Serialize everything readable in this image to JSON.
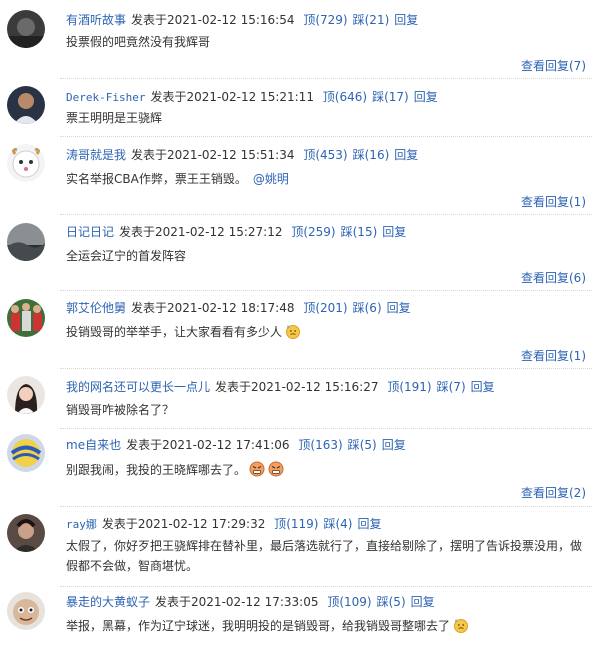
{
  "labels": {
    "posted_prefix": "发表于",
    "up_label": "顶",
    "down_label": "踩",
    "reply_label": "回复",
    "view_replies_label": "查看回复"
  },
  "comments": [
    {
      "username": "有酒听故事",
      "datetime": "2021-02-12 15:16:54",
      "up": "(729)",
      "down": "(21)",
      "text": "投票假的吧竟然没有我辉哥",
      "view_count": "(7)",
      "avatar": "avatar-dark-photo"
    },
    {
      "username": "Derek-Fisher",
      "datetime": "2021-02-12 15:21:11",
      "up": "(646)",
      "down": "(17)",
      "text": "票王明明是王骁辉",
      "avatar": "avatar-player-photo"
    },
    {
      "username": "涛哥就是我",
      "datetime": "2021-02-12 15:51:34",
      "up": "(453)",
      "down": "(16)",
      "text": "实名举报CBA作弊，票王王销毁。",
      "mention": "@姚明",
      "view_count": "(1)",
      "avatar": "avatar-cartoon-sheep"
    },
    {
      "username": "日记日记",
      "datetime": "2021-02-12 15:27:12",
      "up": "(259)",
      "down": "(15)",
      "text": "全运会辽宁的首发阵容",
      "view_count": "(6)",
      "avatar": "avatar-grey-landscape"
    },
    {
      "username": "郭艾伦他舅",
      "datetime": "2021-02-12 18:17:48",
      "up": "(201)",
      "down": "(6)",
      "text": "投销毁哥的举举手，让大家看看有多少人",
      "emoji": "sweat-emoji",
      "view_count": "(1)",
      "avatar": "avatar-team-photo"
    },
    {
      "username": "我的网名还可以更长一点儿",
      "datetime": "2021-02-12 15:16:27",
      "up": "(191)",
      "down": "(7)",
      "text": "销毁哥咋被除名了？",
      "avatar": "avatar-girl-photo"
    },
    {
      "username": "me自来也",
      "datetime": "2021-02-12 17:41:06",
      "up": "(163)",
      "down": "(5)",
      "text": "别跟我闹，我投的王晓辉哪去了。",
      "emoji_double": "angry-emoji",
      "view_count": "(2)",
      "avatar": "avatar-ball-photo"
    },
    {
      "username": "ray娜",
      "datetime": "2021-02-12 17:29:32",
      "up": "(119)",
      "down": "(4)",
      "text": "太假了，你好歹把王骁辉排在替补里，最后落选就行了，直接给剔除了，摆明了告诉投票没用，做假都不会做，智商堪忧。",
      "avatar": "avatar-person-photo"
    },
    {
      "username": "暴走的大黄蚁子",
      "datetime": "2021-02-12 17:33:05",
      "up": "(109)",
      "down": "(5)",
      "text": "举报，黑幕，作为辽宁球迷，我明明投的是销毁哥，给我销毁哥整哪去了",
      "emoji": "sweat-emoji",
      "avatar": "avatar-cartoon-face"
    }
  ]
}
